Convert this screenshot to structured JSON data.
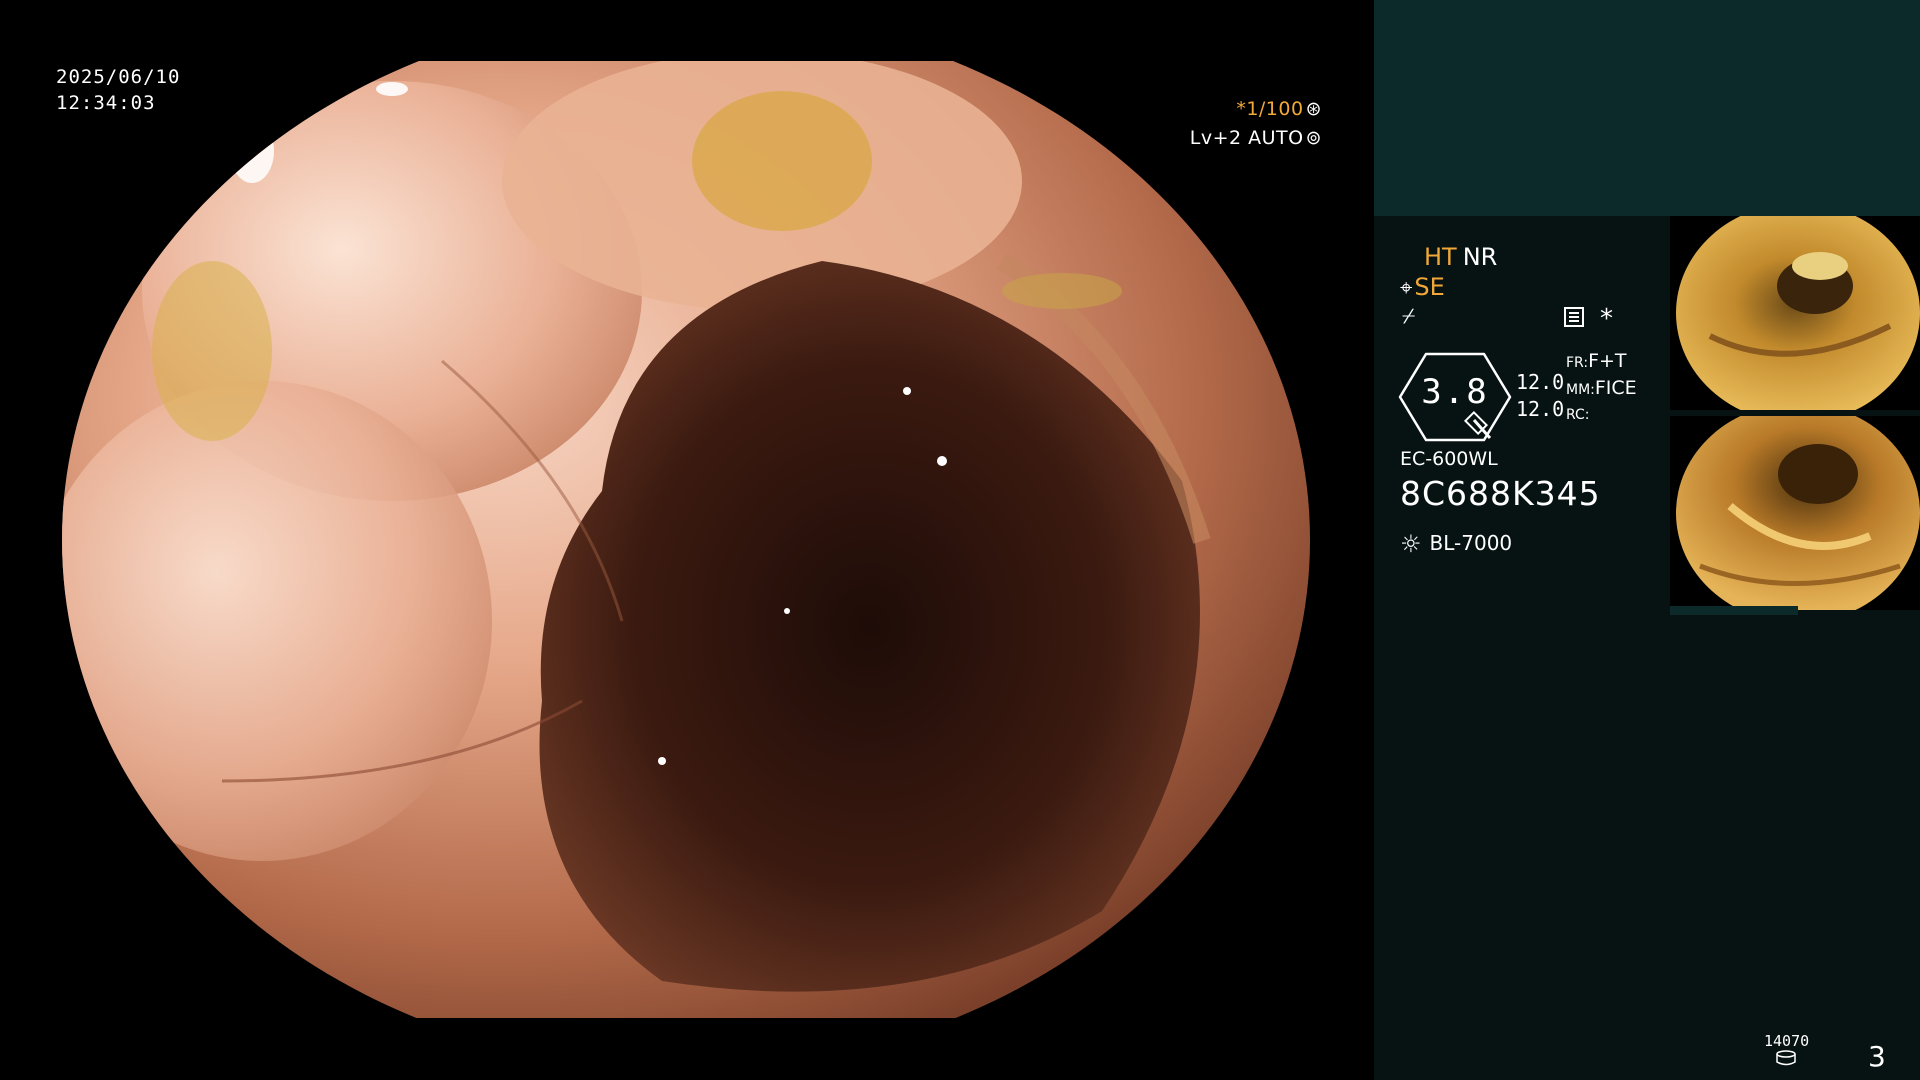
{
  "overlay": {
    "date": "2025/06/10",
    "time": "12:34:03",
    "shutter": "*1/100",
    "shutter_icon": "aperture-icon",
    "level": "Lv+2 AUTO",
    "level_icon": "auto-iris-icon"
  },
  "side": {
    "ht": "HT",
    "nr": "NR",
    "se": "SE",
    "gauge_value": "3.8",
    "value_a": "12.0",
    "value_b": "12.0",
    "fr_label": "FR:",
    "fr_value": "F+T",
    "mm_label": "MM:",
    "mm_value": "FICE",
    "rc_label": "RC:",
    "model": "EC-600WL",
    "serial": "8C688K345",
    "light_source": "BL-7000",
    "counter": "14070",
    "page": "3"
  },
  "colors": {
    "accent": "#f0a838",
    "panel_top": "#0c2a2a",
    "panel": "#071212"
  }
}
